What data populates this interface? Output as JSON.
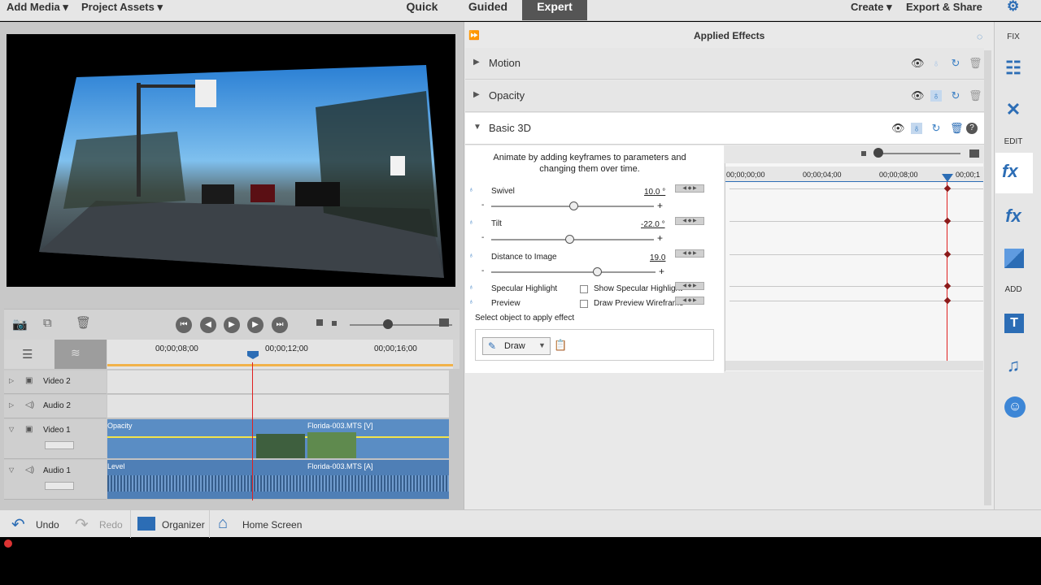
{
  "topbar": {
    "add_media": "Add Media",
    "project_assets": "Project Assets",
    "mode_quick": "Quick",
    "mode_guided": "Guided",
    "mode_expert": "Expert",
    "create": "Create",
    "export_share": "Export & Share"
  },
  "timeline": {
    "ruler_ticks": [
      "00;00;08;00",
      "00;00;12;00",
      "00;00;16;00"
    ],
    "tracks": {
      "video2": "Video 2",
      "audio2": "Audio 2",
      "video1": "Video 1",
      "audio1": "Audio 1"
    },
    "clips": {
      "v1_a": "Opacity",
      "v1_b": "Florida-003.MTS [V]",
      "a1_a": "Level",
      "a1_b": "Florida-003.MTS [A]"
    }
  },
  "effects_panel": {
    "title": "Applied Effects",
    "effects": [
      "Motion",
      "Opacity",
      "Basic 3D"
    ],
    "hint": "Animate by adding keyframes to parameters and changing them over time.",
    "params": {
      "swivel_label": "Swivel",
      "swivel_value": "10.0 °",
      "tilt_label": "Tilt",
      "tilt_value": "-22.0 °",
      "distance_label": "Distance to Image",
      "distance_value": "19.0",
      "specular_label": "Specular Highlight",
      "specular_checkbox": "Show Specular Highlight",
      "preview_label": "Preview",
      "preview_checkbox": "Draw Preview Wireframe"
    },
    "select_hint": "Select object to apply effect",
    "draw_button": "Draw",
    "kf_ticks": [
      "00;00;00;00",
      "00;00;04;00",
      "00;00;08;00",
      "00;00;1"
    ]
  },
  "sidebar": {
    "fix": "FIX",
    "edit": "EDIT",
    "add": "ADD"
  },
  "bottombar": {
    "undo": "Undo",
    "redo": "Redo",
    "organizer": "Organizer",
    "home_screen": "Home Screen"
  },
  "colors": {
    "accent": "#2c6db5",
    "playhead": "#e02020",
    "clip_blue": "#5a8dc4",
    "keyframe": "#8b1a1a"
  }
}
